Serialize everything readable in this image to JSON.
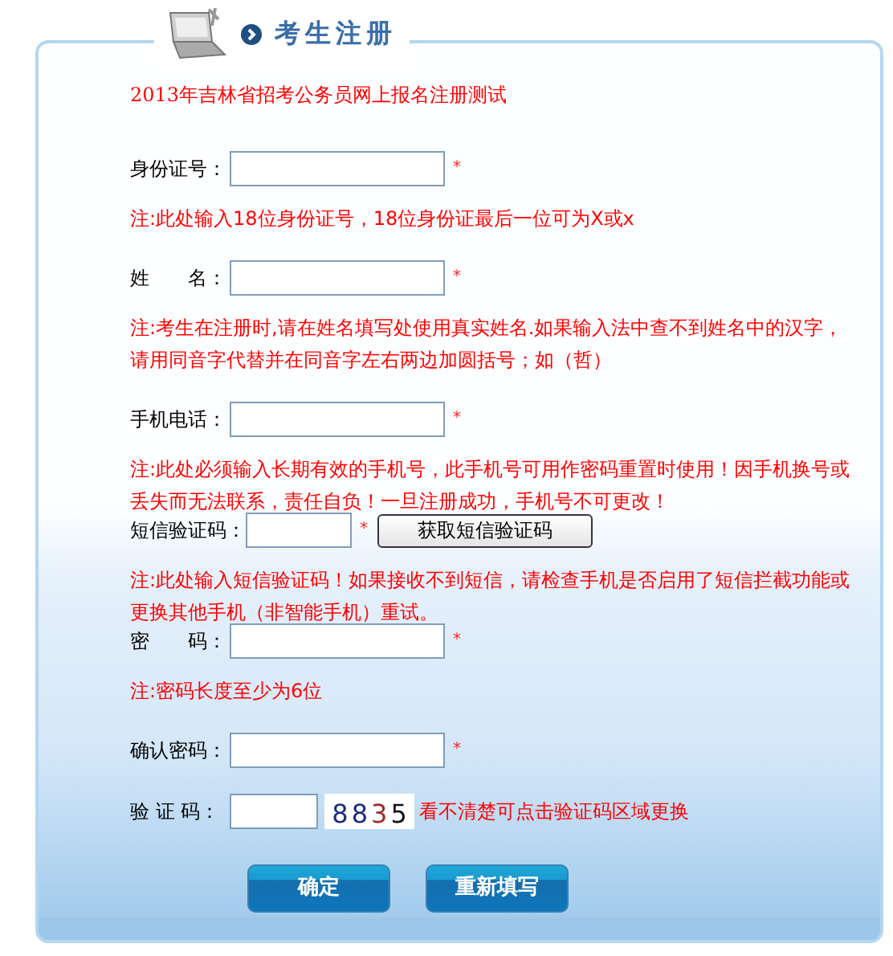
{
  "header": {
    "title": "考生注册"
  },
  "subtitle": "2013年吉林省招考公务员网上报名注册测试",
  "fields": [
    {
      "kind": "input",
      "label": "身份证号：",
      "required_mark": "*",
      "note": "注:此处输入18位身份证号，18位身份证最后一位可为X或x"
    },
    {
      "kind": "input",
      "label": "姓　　名：",
      "required_mark": "*",
      "note": "注:考生在注册时,请在姓名填写处使用真实姓名.如果输入法中查不到姓名中的汉字，请用同音字代替并在同音字左右两边加圆括号；如（哲）"
    },
    {
      "kind": "input",
      "label": "手机电话：",
      "required_mark": "*",
      "note": "注:此处必须输入长期有效的手机号，此手机号可用作密码重置时使用！因手机换号或丢失而无法联系，责任自负！一旦注册成功，手机号不可更改！"
    },
    {
      "kind": "sms",
      "label": "短信验证码：",
      "required_mark": "*",
      "button": "获取短信验证码",
      "note": "注:此处输入短信验证码！如果接收不到短信，请检查手机是否启用了短信拦截功能或更换其他手机（非智能手机）重试。"
    },
    {
      "kind": "input",
      "label": "密　　码：",
      "required_mark": "*",
      "note": "注:密码长度至少为6位"
    },
    {
      "kind": "input",
      "label": "确认密码：",
      "required_mark": "*"
    },
    {
      "kind": "captcha",
      "label": "验 证 码：",
      "captcha_digits": [
        {
          "text": "8",
          "color": "#1a2a80"
        },
        {
          "text": "8",
          "color": "#1a2a80"
        },
        {
          "text": "3",
          "color": "#a02828"
        },
        {
          "text": "5",
          "color": "#111111"
        }
      ],
      "hint": "看不清楚可点击验证码区域更换"
    }
  ],
  "buttons": [
    "确定",
    "重新填写"
  ]
}
